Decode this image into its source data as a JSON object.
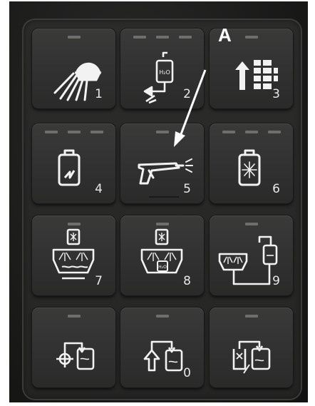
{
  "callout": {
    "label": "A"
  },
  "keypad": {
    "keys": [
      {
        "number": "1",
        "icon": "work-light-icon",
        "leds": 1
      },
      {
        "number": "2",
        "icon": "water-tank-drain-icon",
        "leds": 3
      },
      {
        "number": "3",
        "icon": "level-up-icon",
        "leds": 1
      },
      {
        "number": "4",
        "icon": "tank-level-icon",
        "leds": 3
      },
      {
        "number": "5",
        "icon": "pressure-washer-gun-icon",
        "leds": 1
      },
      {
        "number": "6",
        "icon": "tank-lamp-icon",
        "leds": 3
      },
      {
        "number": "7",
        "icon": "hopper-spray-icon",
        "leds": 1
      },
      {
        "number": "8",
        "icon": "hopper-spray-water-icon",
        "leds": 1
      },
      {
        "number": "9",
        "icon": "hopper-drain-to-tank-icon",
        "leds": 1
      },
      {
        "number": "",
        "icon": "fill-target-tank-icon",
        "leds": 1
      },
      {
        "number": "0",
        "icon": "fill-up-tank-icon",
        "leds": 1
      },
      {
        "number": "",
        "icon": "recirculate-tank-icon",
        "leds": 1
      }
    ]
  },
  "icon_labels": {
    "key2_tank": "H₂O",
    "key8_tank": "H₂O"
  }
}
